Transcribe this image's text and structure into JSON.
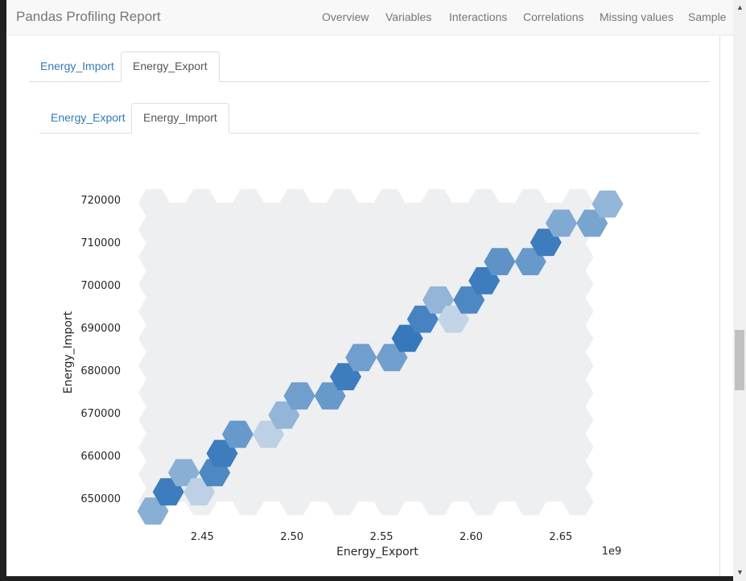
{
  "navbar": {
    "brand": "Pandas Profiling Report",
    "links": [
      "Overview",
      "Variables",
      "Interactions",
      "Correlations",
      "Missing values",
      "Sample"
    ]
  },
  "outer_tabs": [
    {
      "label": "Energy_Import",
      "active": false
    },
    {
      "label": "Energy_Export",
      "active": true
    }
  ],
  "inner_tabs": [
    {
      "label": "Energy_Export",
      "active": false
    },
    {
      "label": "Energy_Import",
      "active": true
    }
  ],
  "chart_data": {
    "type": "hexbin",
    "xlabel": "Energy_Export",
    "ylabel": "Energy_Import",
    "x_offset_label": "1e9",
    "x_ticks": [
      2.45,
      2.5,
      2.55,
      2.6,
      2.65
    ],
    "y_ticks": [
      650000,
      660000,
      670000,
      680000,
      690000,
      700000,
      710000,
      720000
    ],
    "xlim": [
      2.4144,
      2.6806
    ],
    "ylim": [
      645500,
      722500
    ],
    "background_color": "#eeeff1",
    "cells": [
      {
        "x": 2.4225,
        "y": 647000,
        "density": 0.45
      },
      {
        "x": 2.4311,
        "y": 651500,
        "density": 0.9
      },
      {
        "x": 2.4397,
        "y": 656000,
        "density": 0.45
      },
      {
        "x": 2.4483,
        "y": 651500,
        "density": 0.15
      },
      {
        "x": 2.4569,
        "y": 656000,
        "density": 0.8
      },
      {
        "x": 2.4611,
        "y": 660500,
        "density": 0.9
      },
      {
        "x": 2.4698,
        "y": 665000,
        "density": 0.65
      },
      {
        "x": 2.4869,
        "y": 665000,
        "density": 0.15
      },
      {
        "x": 2.4956,
        "y": 669500,
        "density": 0.4
      },
      {
        "x": 2.5042,
        "y": 674000,
        "density": 0.6
      },
      {
        "x": 2.5213,
        "y": 674000,
        "density": 0.65
      },
      {
        "x": 2.53,
        "y": 678500,
        "density": 0.9
      },
      {
        "x": 2.5386,
        "y": 683000,
        "density": 0.6
      },
      {
        "x": 2.5558,
        "y": 683000,
        "density": 0.6
      },
      {
        "x": 2.5644,
        "y": 687500,
        "density": 0.95
      },
      {
        "x": 2.573,
        "y": 692000,
        "density": 0.85
      },
      {
        "x": 2.5816,
        "y": 696500,
        "density": 0.4
      },
      {
        "x": 2.5902,
        "y": 692000,
        "density": 0.12
      },
      {
        "x": 2.5988,
        "y": 696500,
        "density": 0.8
      },
      {
        "x": 2.6073,
        "y": 701000,
        "density": 0.9
      },
      {
        "x": 2.6159,
        "y": 705500,
        "density": 0.7
      },
      {
        "x": 2.6331,
        "y": 705500,
        "density": 0.65
      },
      {
        "x": 2.6417,
        "y": 710000,
        "density": 0.9
      },
      {
        "x": 2.6503,
        "y": 714500,
        "density": 0.5
      },
      {
        "x": 2.6675,
        "y": 714500,
        "density": 0.55
      },
      {
        "x": 2.6761,
        "y": 719000,
        "density": 0.4
      }
    ]
  }
}
